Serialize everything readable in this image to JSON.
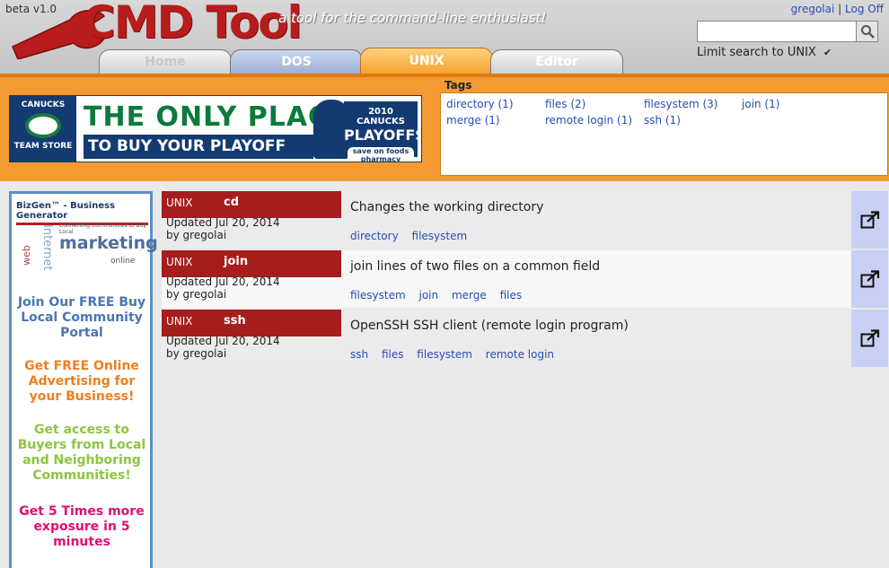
{
  "header": {
    "version": "beta v1.0",
    "logo_text": "CMD Tool",
    "tagline": "a tool for the command-line enthusiast!",
    "user": "gregolai",
    "separator": "|",
    "logoff": "Log Off",
    "search": {
      "value": "",
      "placeholder": ""
    },
    "limit_label": "Limit search to UNIX",
    "limit_checked": true
  },
  "tabs": [
    {
      "label": "Home",
      "active": false
    },
    {
      "label": "DOS",
      "active": false
    },
    {
      "label": "UNIX",
      "active": true
    },
    {
      "label": "Editor",
      "active": false
    }
  ],
  "banner": {
    "store_line1": "CANUCKS",
    "store_line2": "TEAM STORE",
    "line1": "THE ONLY PLACE",
    "line2": "TO BUY YOUR PLAYOFF GEAR",
    "playoffs_line1": "2010 CANUCKS",
    "playoffs_line2": "PLAYOFFS",
    "playoffs_line3": "save on foods pharmacy"
  },
  "tags": {
    "title": "Tags",
    "items": [
      "directory (1)",
      "files (2)",
      "filesystem (3)",
      "join (1)",
      "merge (1)",
      "remote login (1)",
      "ssh (1)"
    ]
  },
  "side_ad": {
    "title": "BizGen™ - Business Generator",
    "collage": {
      "connecting": "Connecting Communities to Buy Local",
      "marketing": "marketing",
      "internet": "Internet",
      "web": "web",
      "online": "online"
    },
    "messages": [
      {
        "text": "Join Our FREE Buy Local Community Portal",
        "color": "#4a76b0"
      },
      {
        "text": "Get FREE Online Advertising for your Business!",
        "color": "#f07f1d"
      },
      {
        "text": "Get access to Buyers from Local and Neighboring Communities!",
        "color": "#8cc63f"
      },
      {
        "text": "Get 5 Times more exposure in 5 minutes",
        "color": "#e0106f"
      }
    ]
  },
  "commands": [
    {
      "os": "UNIX",
      "name": "cd",
      "updated": "Updated Jul 20, 2014",
      "by": "by gregolai",
      "description": "Changes the working directory",
      "tags": [
        "directory",
        "filesystem"
      ]
    },
    {
      "os": "UNIX",
      "name": "join",
      "updated": "Updated Jul 20, 2014",
      "by": "by gregolai",
      "description": "join lines of two files on a common field",
      "tags": [
        "filesystem",
        "join",
        "merge",
        "files"
      ]
    },
    {
      "os": "UNIX",
      "name": "ssh",
      "updated": "Updated Jul 20, 2014",
      "by": "by gregolai",
      "description": "OpenSSH SSH client (remote login program)",
      "tags": [
        "ssh",
        "files",
        "filesystem",
        "remote login"
      ]
    }
  ],
  "icons": {
    "search": "search-icon",
    "open": "external-link-icon",
    "checkbox": "check-icon"
  },
  "colors": {
    "accent_orange": "#f39a33",
    "command_red": "#a61d1d",
    "link_blue": "#2a4bb5",
    "open_button": "#c9cff4"
  }
}
